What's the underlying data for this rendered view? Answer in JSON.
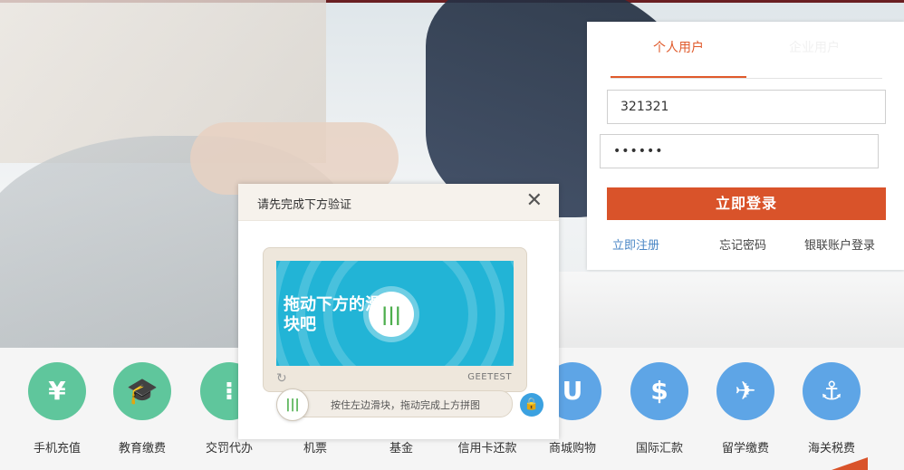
{
  "login": {
    "tabs": [
      {
        "label": "个人用户"
      },
      {
        "label": "企业用户"
      }
    ],
    "username": "321321",
    "password_mask": "••••••",
    "submit_label": "立即登录",
    "links": {
      "register": "立即注册",
      "forgot": "忘记密码",
      "unionpay": "银联账户登录"
    }
  },
  "captcha": {
    "title": "请先完成下方验证",
    "image_text": "拖动下方的滑块吧",
    "brand": "GEETEST",
    "slider_hint": "按住左边滑块，拖动完成上方拼图"
  },
  "services": [
    {
      "label": "手机充值",
      "icon": "phone-yen-icon"
    },
    {
      "label": "教育缴费",
      "icon": "graduation-cap-icon"
    },
    {
      "label": "交罚代办",
      "icon": "traffic-light-icon"
    },
    {
      "label": "机票",
      "icon": "plane-icon"
    },
    {
      "label": "基金",
      "icon": "fund-icon"
    },
    {
      "label": "信用卡还款",
      "icon": "credit-card-icon"
    },
    {
      "label": "商城购物",
      "icon": "shopping-bag-icon"
    },
    {
      "label": "国际汇款",
      "icon": "dollar-swirl-icon"
    },
    {
      "label": "留学缴费",
      "icon": "plane-dollar-icon"
    },
    {
      "label": "海关税费",
      "icon": "anchor-icon"
    }
  ],
  "colors": {
    "accent": "#d9532a",
    "link": "#4a86c5",
    "green_icon": "#5fc69c",
    "blue_icon": "#5ea5e6"
  }
}
